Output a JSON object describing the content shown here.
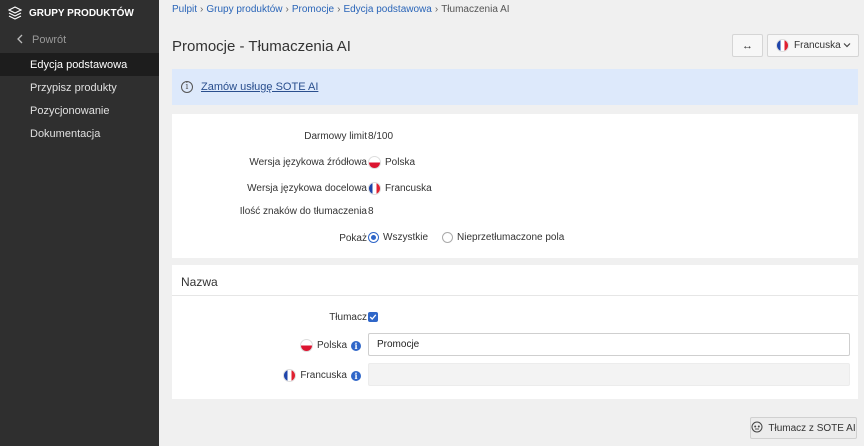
{
  "sidebar": {
    "title": "GRUPY PRODUKTÓW",
    "back_label": "Powrót",
    "items": [
      {
        "label": "Edycja podstawowa",
        "active": true
      },
      {
        "label": "Przypisz produkty",
        "active": false
      },
      {
        "label": "Pozycjonowanie",
        "active": false
      },
      {
        "label": "Dokumentacja",
        "active": false
      }
    ]
  },
  "breadcrumb": {
    "items": [
      "Pulpit",
      "Grupy produktów",
      "Promocje",
      "Edycja podstawowa"
    ],
    "current": "Tłumaczenia AI",
    "separator": "›"
  },
  "header": {
    "title": "Promocje - Tłumaczenia AI",
    "swap_label": "↔",
    "language_selected": "Francuska"
  },
  "alert": {
    "link_text": "Zamów usługę SOTE AI"
  },
  "info_panel": {
    "free_limit_label": "Darmowy limit",
    "free_limit_value": "8/100",
    "source_lang_label": "Wersja językowa źródłowa",
    "source_lang_value": "Polska",
    "target_lang_label": "Wersja językowa docelowa",
    "target_lang_value": "Francuska",
    "chars_label": "Ilość znaków do tłumaczenia",
    "chars_value": "8",
    "show_label": "Pokaż",
    "show_options": [
      {
        "label": "Wszystkie",
        "selected": true
      },
      {
        "label": "Nieprzetłumaczone pola",
        "selected": false
      }
    ]
  },
  "name_panel": {
    "title": "Nazwa",
    "translate_label": "Tłumacz",
    "translate_checked": true,
    "source_label": "Polska",
    "source_value": "Promocje",
    "target_label": "Francuska",
    "target_value": ""
  },
  "footer": {
    "translate_button": "Tłumacz z SOTE AI"
  },
  "colors": {
    "sidebar_bg": "#2f2f2f",
    "accent": "#2f66c8",
    "link": "#2a65b8",
    "alert_bg": "#dde9fb"
  }
}
